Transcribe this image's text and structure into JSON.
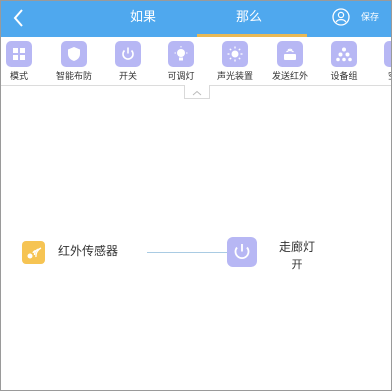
{
  "header": {
    "tabs": [
      {
        "label": "如果",
        "active": false
      },
      {
        "label": "那么",
        "active": true
      }
    ],
    "save_label": "保存",
    "accent_color": "#4fa8ee",
    "active_underline_color": "#e9b955"
  },
  "toolbar": {
    "items": [
      {
        "label": "模式",
        "icon": "grid-icon"
      },
      {
        "label": "智能布防",
        "icon": "shield-icon"
      },
      {
        "label": "开关",
        "icon": "power-icon"
      },
      {
        "label": "可调灯",
        "icon": "bulb-icon"
      },
      {
        "label": "声光装置",
        "icon": "siren-icon"
      },
      {
        "label": "发送红外",
        "icon": "ir-emitter-icon"
      },
      {
        "label": "设备组",
        "icon": "device-group-icon"
      },
      {
        "label": "空气",
        "icon": "air-icon"
      }
    ],
    "icon_color": "#b7b7f4"
  },
  "canvas": {
    "trigger": {
      "label": "红外传感器",
      "icon": "infrared-sensor-icon",
      "color": "#f6c453"
    },
    "action": {
      "title": "走廊灯",
      "state": "开",
      "icon": "power-icon",
      "color": "#b7b7f4"
    }
  }
}
